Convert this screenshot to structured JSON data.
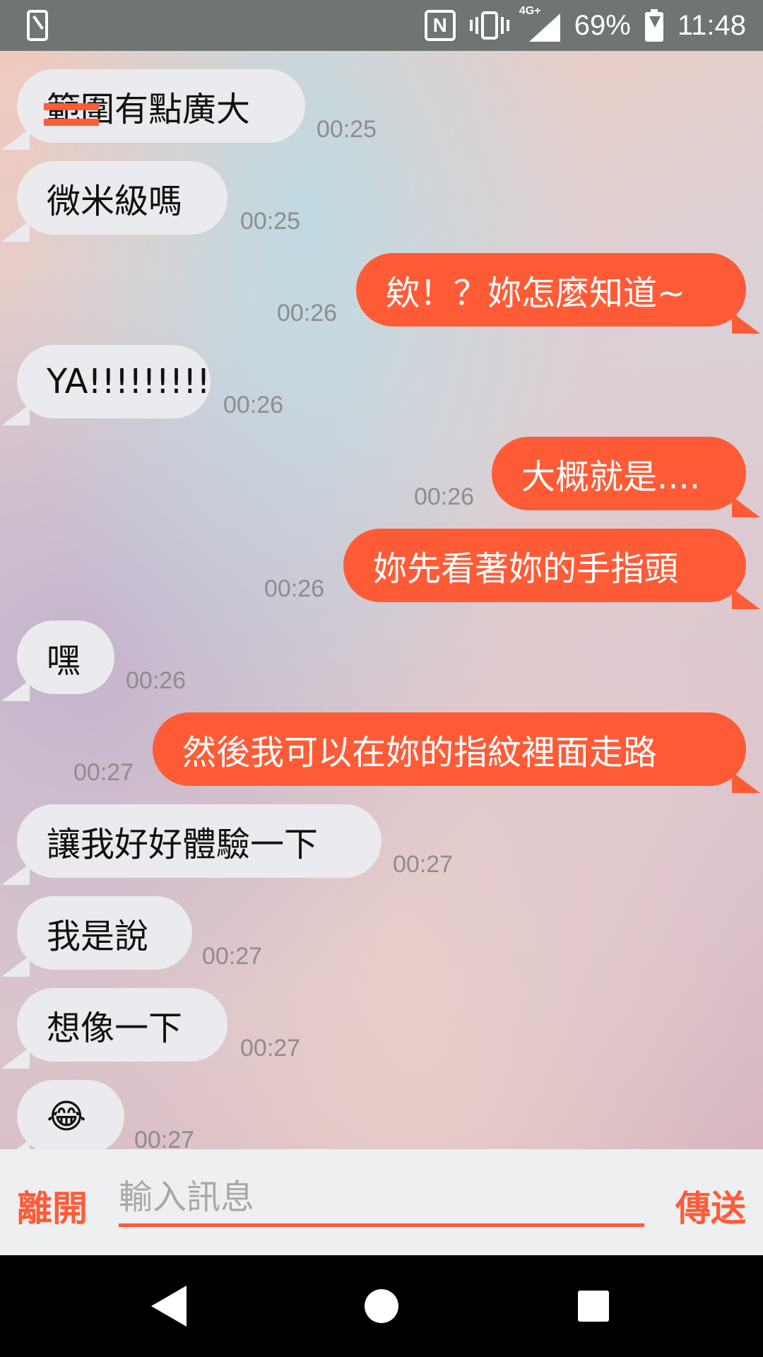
{
  "status_bar": {
    "left_icon": "sim-card-icon",
    "icons": [
      "nfc-icon",
      "vibrate-icon",
      "signal-icon",
      "battery-charging-icon"
    ],
    "network": "4G+",
    "battery": "69%",
    "time": "11:48"
  },
  "colors": {
    "accent": "#ff5b37",
    "incoming_bubble": "#ebeaee",
    "timestamp": "#8f8c90"
  },
  "messages": [
    {
      "direction": "in",
      "text": "範圍有點廣大",
      "time": "00:25"
    },
    {
      "direction": "in",
      "text": "微米級嗎",
      "time": "00:25"
    },
    {
      "direction": "out",
      "text": "欸！？妳怎麼知道~",
      "time": "00:26"
    },
    {
      "direction": "in",
      "text": "YA!!!!!!!!!",
      "time": "00:26"
    },
    {
      "direction": "out",
      "text": "大概就是....",
      "time": "00:26"
    },
    {
      "direction": "out",
      "text": "妳先看著妳的手指頭",
      "time": "00:26"
    },
    {
      "direction": "in",
      "text": "嘿",
      "time": "00:26"
    },
    {
      "direction": "out",
      "text": "然後我可以在妳的指紋裡面走路",
      "time": "00:27"
    },
    {
      "direction": "in",
      "text": "讓我好好體驗一下",
      "time": "00:27"
    },
    {
      "direction": "in",
      "text": "我是說",
      "time": "00:27"
    },
    {
      "direction": "in",
      "text": "想像一下",
      "time": "00:27"
    },
    {
      "direction": "in",
      "text": "😂",
      "time": "00:27"
    }
  ],
  "input_bar": {
    "leave_label": "離開",
    "placeholder": "輸入訊息",
    "value": "",
    "send_label": "傳送"
  },
  "nav_bar": {
    "icons": [
      "back-icon",
      "home-icon",
      "recent-apps-icon"
    ]
  }
}
